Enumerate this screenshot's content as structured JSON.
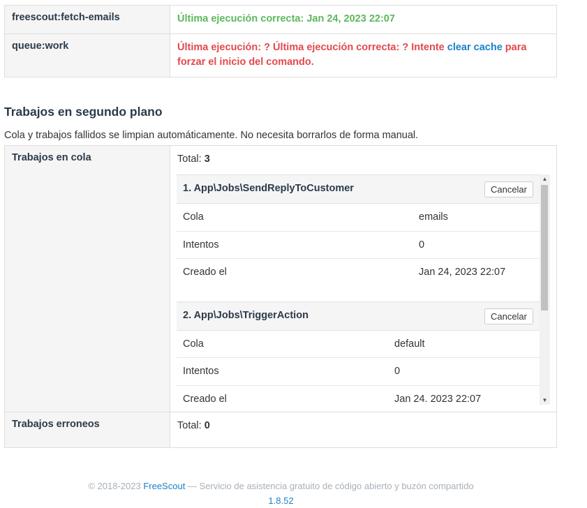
{
  "status_table": [
    {
      "name": "freescout:fetch-emails",
      "ok_text": "Última ejecución correcta: Jan 24, 2023 22:07"
    },
    {
      "name": "queue:work",
      "err_text_1": "Última ejecución: ? Última ejecución correcta: ? Intente ",
      "link_text": "clear cache",
      "err_text_2": " para forzar el inicio del comando."
    }
  ],
  "section": {
    "title": "Trabajos en segundo plano",
    "description": "Cola y trabajos fallidos se limpian automáticamente. No necesita borrarlos de forma manual."
  },
  "queued": {
    "label": "Trabajos en cola",
    "total_label": "Total: ",
    "total": "3",
    "jobs": [
      {
        "title": "1. App\\Jobs\\SendReplyToCustomer",
        "cancel": "Cancelar",
        "rows": [
          {
            "k": "Cola",
            "v": "emails"
          },
          {
            "k": "Intentos",
            "v": "0"
          },
          {
            "k": "Creado el",
            "v": "Jan 24, 2023 22:07"
          }
        ]
      },
      {
        "title": "2. App\\Jobs\\TriggerAction",
        "cancel": "Cancelar",
        "rows": [
          {
            "k": "Cola",
            "v": "default"
          },
          {
            "k": "Intentos",
            "v": "0"
          },
          {
            "k": "Creado el",
            "v": "Jan 24. 2023 22:07"
          }
        ]
      }
    ]
  },
  "failed": {
    "label": "Trabajos erroneos",
    "total_label": "Total: ",
    "total": "0"
  },
  "footer": {
    "copyright": "© 2018-2023 ",
    "brand": "FreeScout",
    "tagline": " — Servicio de asistencia gratuito de código abierto y buzón compartido",
    "version": "1.8.52"
  }
}
